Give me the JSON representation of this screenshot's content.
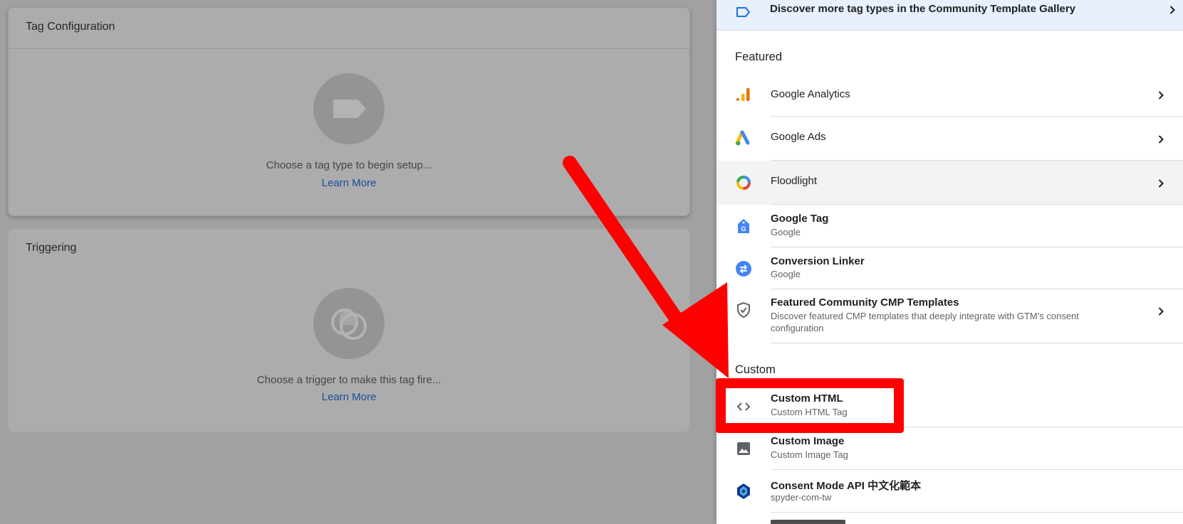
{
  "editor": {
    "tag_configuration": {
      "title": "Tag Configuration",
      "placeholder": "Choose a tag type to begin setup...",
      "learn_more": "Learn More",
      "icon": "tag-icon"
    },
    "triggering": {
      "title": "Triggering",
      "placeholder": "Choose a trigger to make this tag fire...",
      "learn_more": "Learn More",
      "icon": "trigger-icon"
    }
  },
  "panel": {
    "gallery": {
      "label": "Discover more tag types in the Community Template Gallery",
      "icon": "tag-outline-icon"
    },
    "featured": {
      "heading": "Featured",
      "items": [
        {
          "name": "Google Analytics",
          "icon": "google-analytics-icon"
        },
        {
          "name": "Google Ads",
          "icon": "google-ads-icon"
        },
        {
          "name": "Floodlight",
          "icon": "floodlight-icon"
        },
        {
          "name": "Google Tag",
          "sub": "Google",
          "icon": "google-tag-icon"
        },
        {
          "name": "Conversion Linker",
          "sub": "Google",
          "icon": "conversion-linker-icon"
        },
        {
          "name": "Featured Community CMP Templates",
          "sub_line1": "Discover featured CMP templates that deeply integrate with GTM's consent",
          "sub_line2": "configuration",
          "icon": "shield-check-icon"
        }
      ]
    },
    "custom": {
      "heading": "Custom",
      "items": [
        {
          "name": "Custom HTML",
          "sub": "Custom HTML Tag",
          "icon": "code-icon"
        },
        {
          "name": "Custom Image",
          "sub": "Custom Image Tag",
          "icon": "image-icon"
        },
        {
          "name": "Consent Mode API 中文化範本",
          "sub": "spyder-com-tw",
          "icon": "spyder-logo-icon"
        }
      ]
    }
  },
  "colors": {
    "overlay_background": "#a1a1a1",
    "link_blue": "#1a4e9a",
    "annotation_red": "#ff0000",
    "gallery_highlight": "#e8effd",
    "hover_row": "#f1f3f4"
  }
}
